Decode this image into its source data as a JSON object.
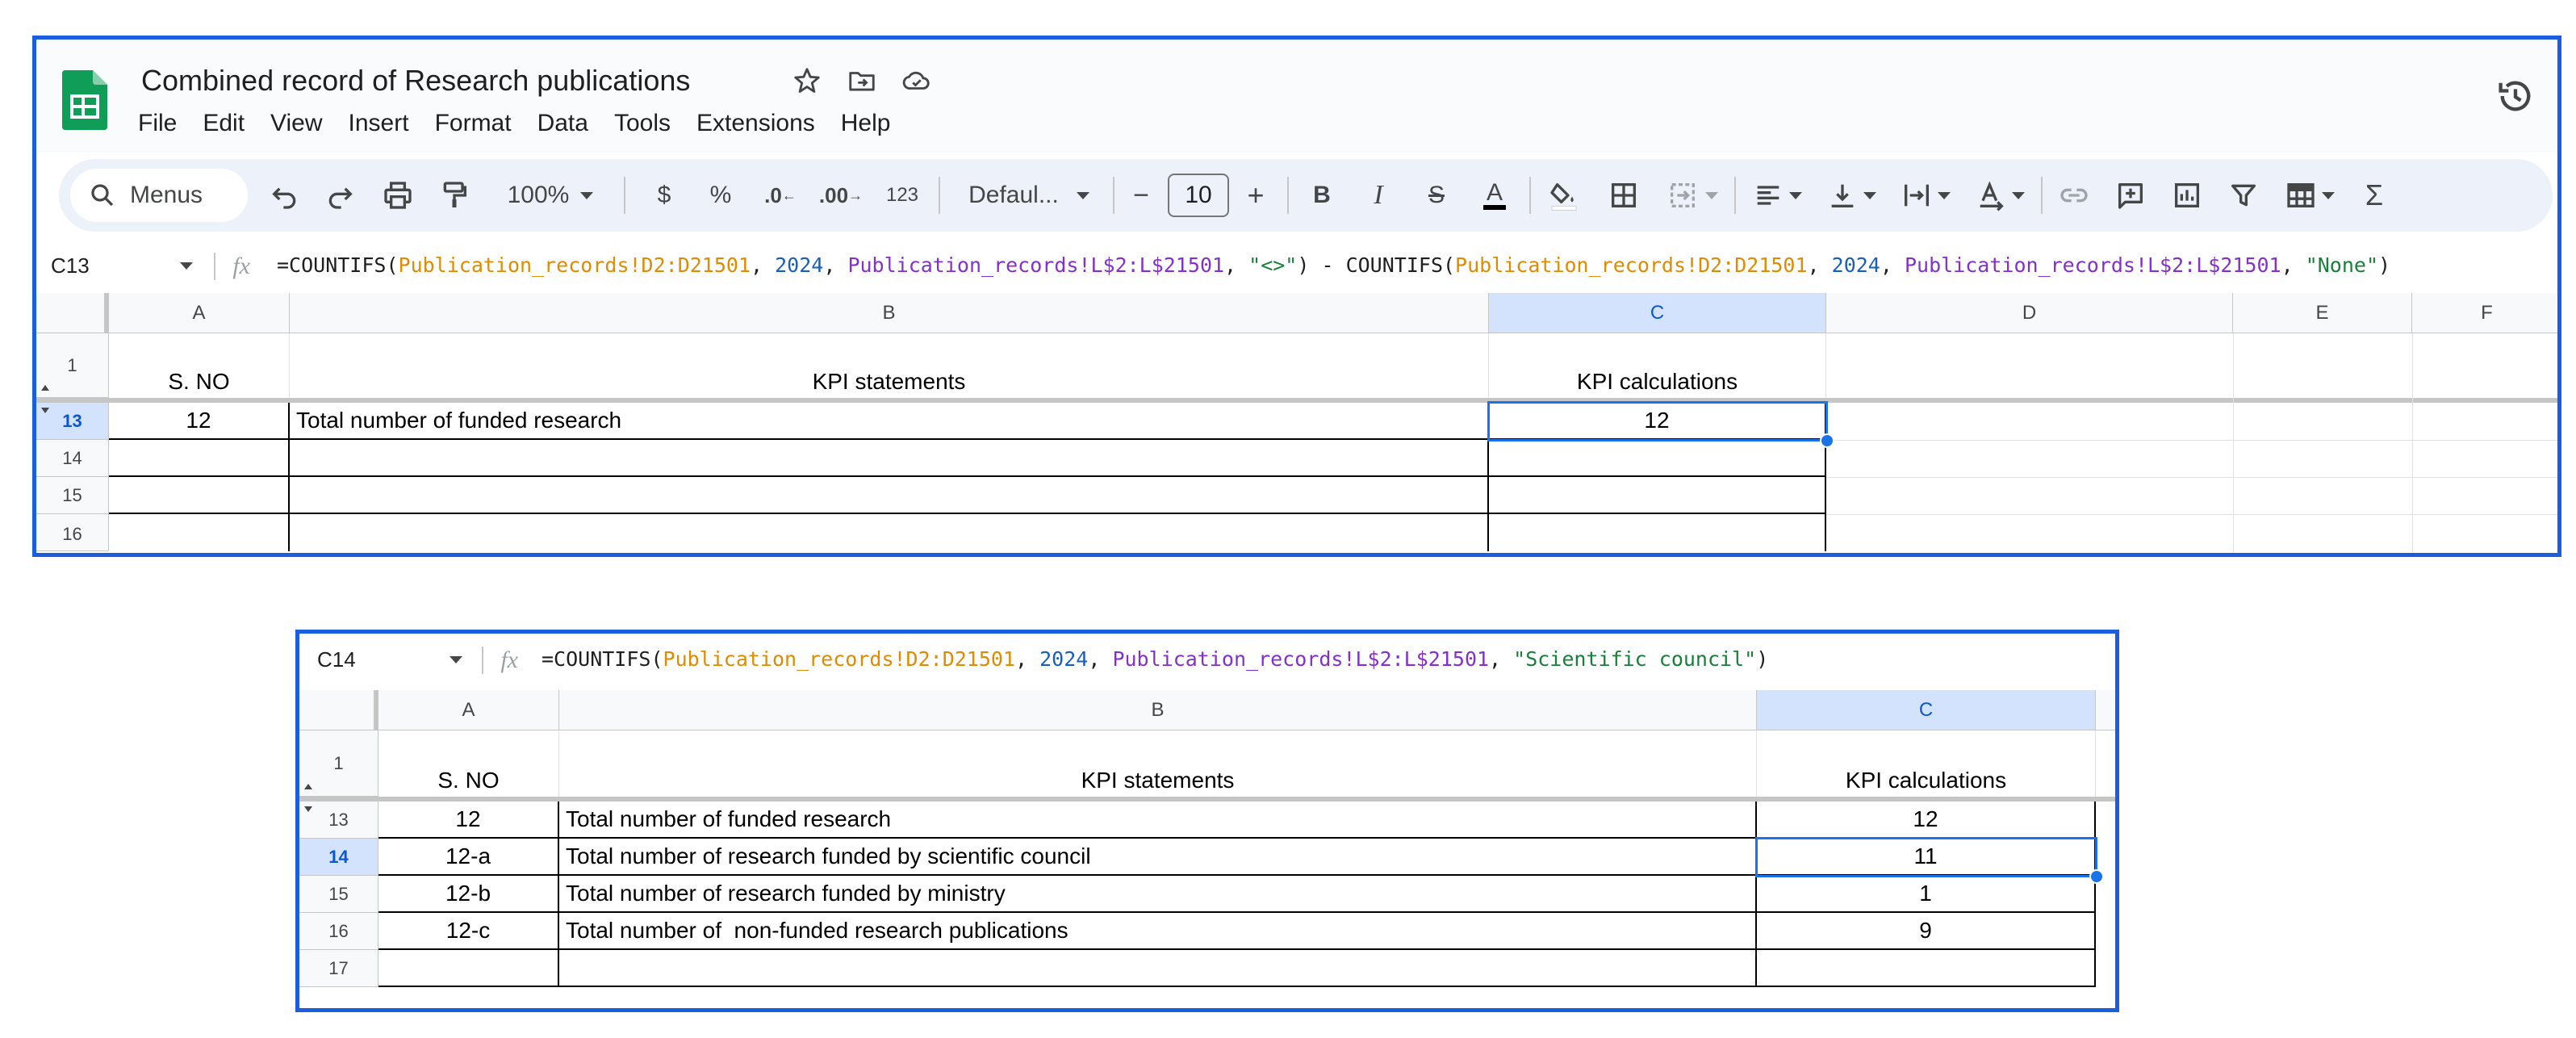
{
  "app": {
    "title": "Combined record of Research publications",
    "menu": [
      "File",
      "Edit",
      "View",
      "Insert",
      "Format",
      "Data",
      "Tools",
      "Extensions",
      "Help"
    ]
  },
  "toolbar": {
    "search_label": "Menus",
    "zoom": "100%",
    "currency": "$",
    "percent": "%",
    "decimal_decrease": ".0",
    "decimal_increase": ".00",
    "number_format": "123",
    "font": "Defaul...",
    "font_size": "10",
    "minus": "−",
    "plus": "+",
    "bold": "B",
    "italic": "I",
    "strike": "S",
    "text_color": "A"
  },
  "sheet1": {
    "name_box": "C13",
    "formula": [
      {
        "t": "=COUNTIFS(",
        "c": "plain"
      },
      {
        "t": "Publication_records!D2:D21501",
        "c": "orange"
      },
      {
        "t": ", ",
        "c": "plain"
      },
      {
        "t": "2024",
        "c": "blue"
      },
      {
        "t": ", ",
        "c": "plain"
      },
      {
        "t": "Publication_records!L$2:L$21501",
        "c": "purple"
      },
      {
        "t": ", ",
        "c": "plain"
      },
      {
        "t": "\"<>\"",
        "c": "green"
      },
      {
        "t": ") - COUNTIFS(",
        "c": "plain"
      },
      {
        "t": "Publication_records!D2:D21501",
        "c": "orange"
      },
      {
        "t": ", ",
        "c": "plain"
      },
      {
        "t": "2024",
        "c": "blue"
      },
      {
        "t": ", ",
        "c": "plain"
      },
      {
        "t": "Publication_records!L$2:L$21501",
        "c": "purple"
      },
      {
        "t": ", ",
        "c": "plain"
      },
      {
        "t": "\"None\"",
        "c": "green"
      },
      {
        "t": ")",
        "c": "plain"
      }
    ],
    "columns": [
      "A",
      "B",
      "C",
      "D",
      "E",
      "F"
    ],
    "header_row": {
      "num": "1",
      "a": "S. NO",
      "b": "KPI statements",
      "c": "KPI calculations"
    },
    "rows": [
      {
        "num": "13",
        "a": "12",
        "b": "Total number of funded research",
        "c": "12"
      },
      {
        "num": "14",
        "a": "",
        "b": "",
        "c": ""
      },
      {
        "num": "15",
        "a": "",
        "b": "",
        "c": ""
      },
      {
        "num": "16",
        "a": "",
        "b": "",
        "c": ""
      }
    ]
  },
  "sheet2": {
    "name_box": "C14",
    "formula": [
      {
        "t": "=COUNTIFS(",
        "c": "plain"
      },
      {
        "t": "Publication_records!D2:D21501",
        "c": "orange"
      },
      {
        "t": ", ",
        "c": "plain"
      },
      {
        "t": "2024",
        "c": "blue"
      },
      {
        "t": ", ",
        "c": "plain"
      },
      {
        "t": "Publication_records!L$2:L$21501",
        "c": "purple"
      },
      {
        "t": ", ",
        "c": "plain"
      },
      {
        "t": "\"Scientific council\"",
        "c": "green"
      },
      {
        "t": ")",
        "c": "plain"
      }
    ],
    "columns": [
      "A",
      "B",
      "C"
    ],
    "header_row": {
      "num": "1",
      "a": "S. NO",
      "b": "KPI statements",
      "c": "KPI calculations"
    },
    "rows": [
      {
        "num": "13",
        "a": "12",
        "b": "Total number of funded research",
        "c": "12"
      },
      {
        "num": "14",
        "a": "12-a",
        "b": "Total number of research funded by scientific council",
        "c": "11"
      },
      {
        "num": "15",
        "a": "12-b",
        "b": "Total number of research funded by ministry",
        "c": "1"
      },
      {
        "num": "16",
        "a": "12-c",
        "b": "Total number of  non-funded research publications",
        "c": "9"
      },
      {
        "num": "17",
        "a": "",
        "b": "",
        "c": ""
      }
    ]
  },
  "colors": {
    "accent": "#1a73e8",
    "frame": "#1a5ee0",
    "selected_header": "#d3e3fd",
    "sheets_green": "#0f9d58"
  },
  "icons": [
    "sheets-logo-icon",
    "star-icon",
    "move-folder-icon",
    "cloud-status-icon",
    "version-history-icon",
    "search-icon",
    "undo-icon",
    "redo-icon",
    "print-icon",
    "paint-format-icon",
    "fill-color-icon",
    "borders-icon",
    "merge-cells-icon",
    "align-left-icon",
    "vertical-align-icon",
    "text-wrap-icon",
    "text-rotation-icon",
    "link-icon",
    "comment-icon",
    "chart-icon",
    "filter-icon",
    "table-view-icon",
    "sum-icon",
    "fx-icon"
  ]
}
